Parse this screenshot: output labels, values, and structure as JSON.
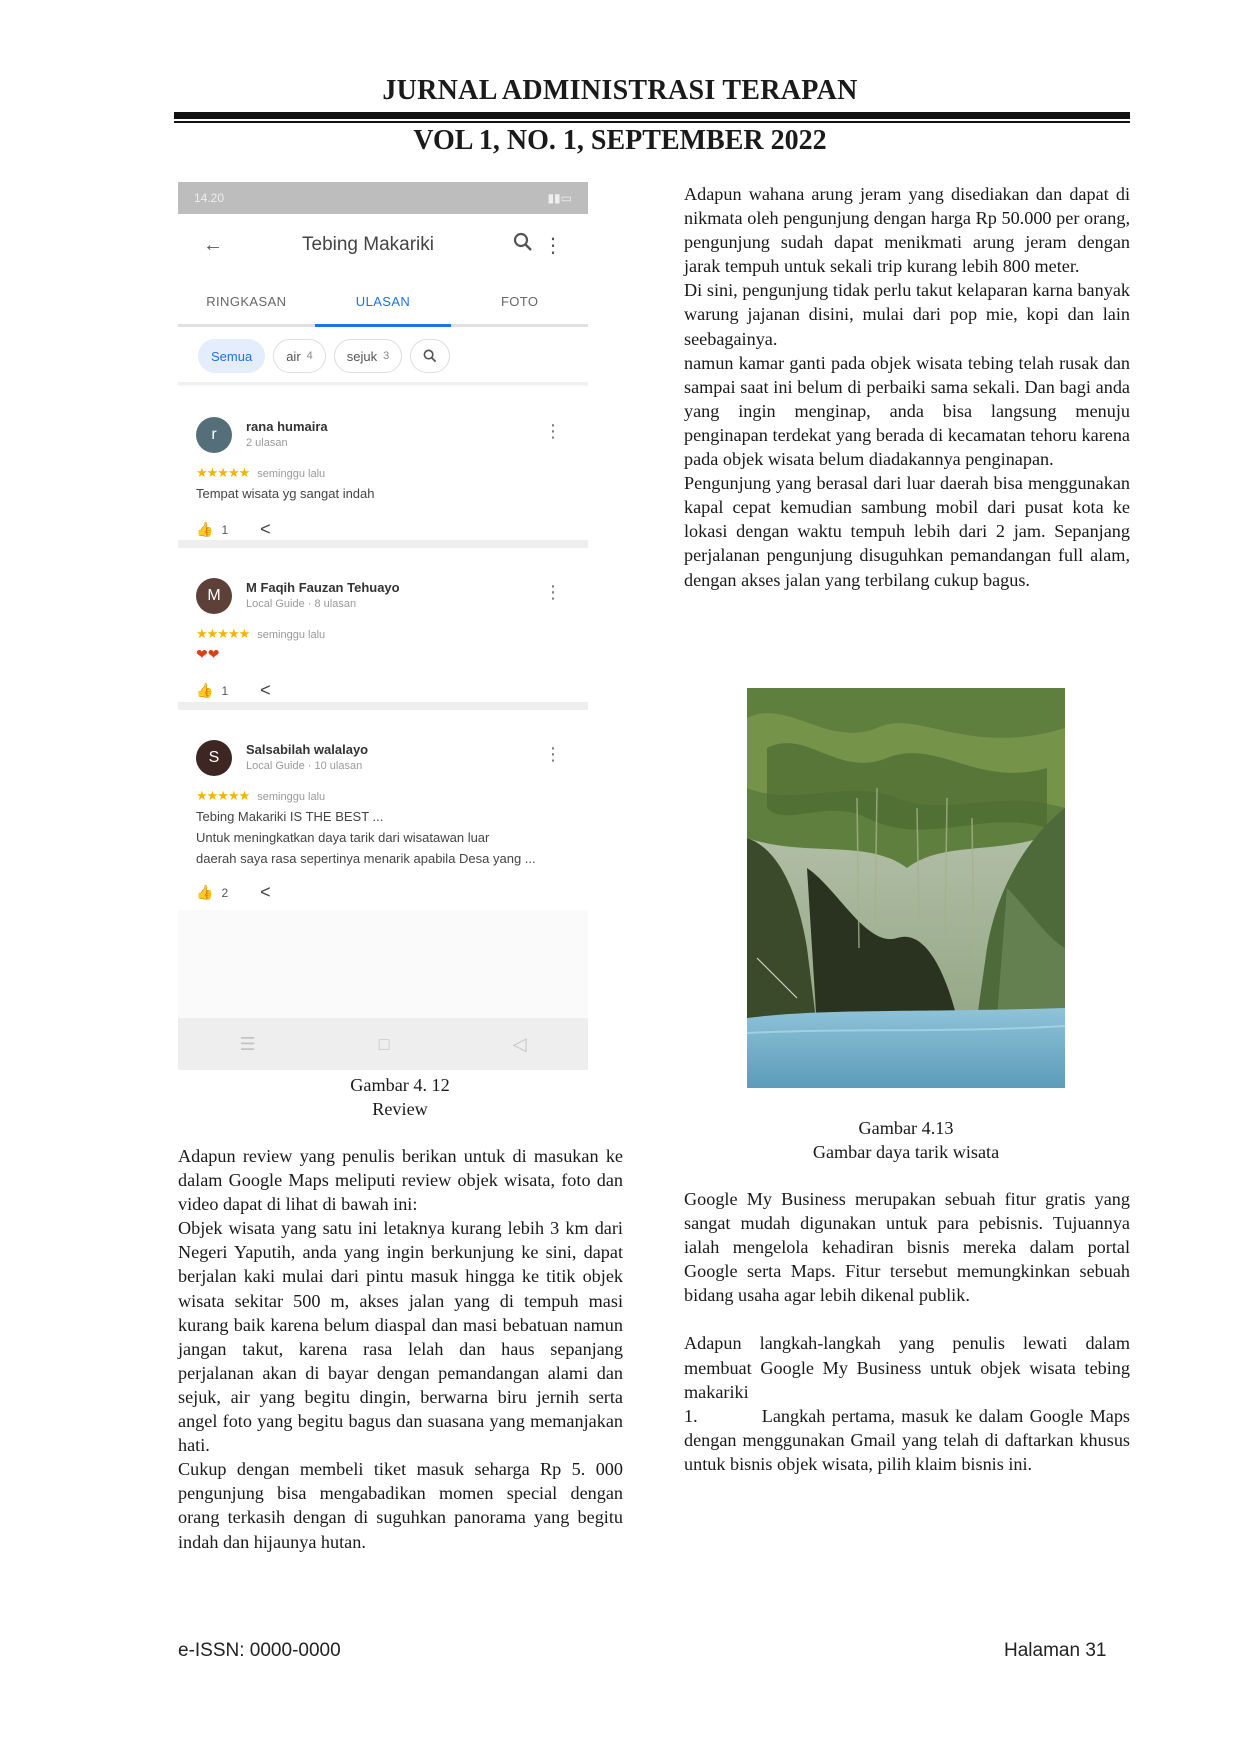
{
  "header": {
    "journal": "JURNAL ADMINISTRASI TERAPAN",
    "volume": "VOL 1, NO. 1, SEPTEMBER 2022"
  },
  "phone": {
    "status_time": "14.20",
    "app_title": "Tebing Makariki",
    "tabs": [
      "RINGKASAN",
      "ULASAN",
      "FOTO"
    ],
    "chips": [
      {
        "label": "Semua",
        "count": ""
      },
      {
        "label": "air",
        "count": "4"
      },
      {
        "label": "sejuk",
        "count": "3"
      }
    ],
    "reviews": [
      {
        "initial": "r",
        "name": "rana humaira",
        "sub": "2 ulasan",
        "when": "seminggu lalu",
        "text": "Tempat wisata yg sangat indah",
        "likes": "1",
        "color": "#546e7a"
      },
      {
        "initial": "M",
        "name": "M Faqih Fauzan Tehuayo",
        "sub": "Local Guide · 8 ulasan",
        "when": "seminggu lalu",
        "text": "",
        "likes": "1",
        "color": "#5d4037"
      },
      {
        "initial": "S",
        "name": "Salsabilah walalayo",
        "sub": "Local Guide · 10 ulasan",
        "when": "seminggu lalu",
        "text": "Tebing Makariki IS THE BEST ...",
        "text2": "Untuk meningkatkan daya tarik dari wisatawan luar",
        "text3": "daerah saya rasa sepertinya menarik apabila Desa yang ...",
        "likes": "2",
        "color": "#3e2723"
      }
    ]
  },
  "left": {
    "caption1": "Gambar 4. 12",
    "caption2": "Review",
    "p1": "Adapun review yang penulis berikan untuk di masukan ke dalam Google Maps meliputi review objek wisata, foto dan video dapat di lihat di bawah ini:",
    "p2": "Objek wisata yang satu ini letaknya kurang lebih 3 km dari Negeri Yaputih, anda yang ingin berkunjung ke sini, dapat berjalan kaki mulai dari pintu masuk hingga ke titik objek wisata sekitar 500 m,  akses jalan yang di tempuh masi kurang baik karena belum diaspal dan masi bebatuan namun jangan takut, karena rasa lelah dan haus sepanjang perjalanan akan di bayar dengan pemandangan alami dan sejuk, air yang begitu dingin, berwarna biru jernih serta angel foto yang begitu bagus dan suasana yang memanjakan hati.",
    "p3": " Cukup dengan membeli tiket masuk seharga Rp 5. 000 pengunjung bisa mengabadikan momen special dengan orang terkasih dengan di suguhkan panorama yang begitu indah dan hijaunya hutan."
  },
  "right": {
    "p1": "Adapun wahana arung jeram yang disediakan dan dapat di nikmata oleh pengunjung dengan harga Rp 50.000 per orang,  pengunjung sudah dapat menikmati arung jeram dengan jarak tempuh untuk sekali trip kurang lebih 800 meter.",
    "p2": "Di sini, pengunjung tidak perlu takut kelaparan karna banyak warung jajanan disini, mulai dari pop mie, kopi dan lain seebagainya.",
    "p3": "namun kamar ganti pada objek wisata tebing telah rusak dan sampai saat ini belum di perbaiki sama sekali. Dan bagi anda yang ingin menginap, anda bisa langsung menuju penginapan terdekat yang berada di kecamatan tehoru karena pada objek wisata belum diadakannya penginapan.",
    "p4": "Pengunjung yang berasal dari luar daerah bisa menggunakan kapal cepat kemudian sambung mobil dari pusat kota ke lokasi dengan waktu tempuh lebih dari 2 jam. Sepanjang perjalanan pengunjung disuguhkan pemandangan full alam, dengan akses jalan yang terbilang cukup bagus.",
    "caption1": "Gambar 4.13",
    "caption2": "Gambar daya tarik wisata",
    "p5": "Google My Business merupakan sebuah fitur gratis yang sangat mudah digunakan untuk para pebisnis. Tujuannya ialah mengelola kehadiran bisnis mereka dalam portal Google serta Maps. Fitur tersebut memungkinkan sebuah bidang usaha agar lebih dikenal publik.",
    "p6": "Adapun langkah-langkah yang penulis lewati dalam membuat Google My Business untuk objek wisata tebing makariki",
    "p7": "1.          Langkah pertama, masuk ke dalam Google Maps dengan menggunakan Gmail yang telah di daftarkan khusus untuk bisnis objek wisata, pilih klaim bisnis ini."
  },
  "footer": {
    "issn": "e-ISSN: 0000-0000",
    "page": "Halaman 31"
  }
}
